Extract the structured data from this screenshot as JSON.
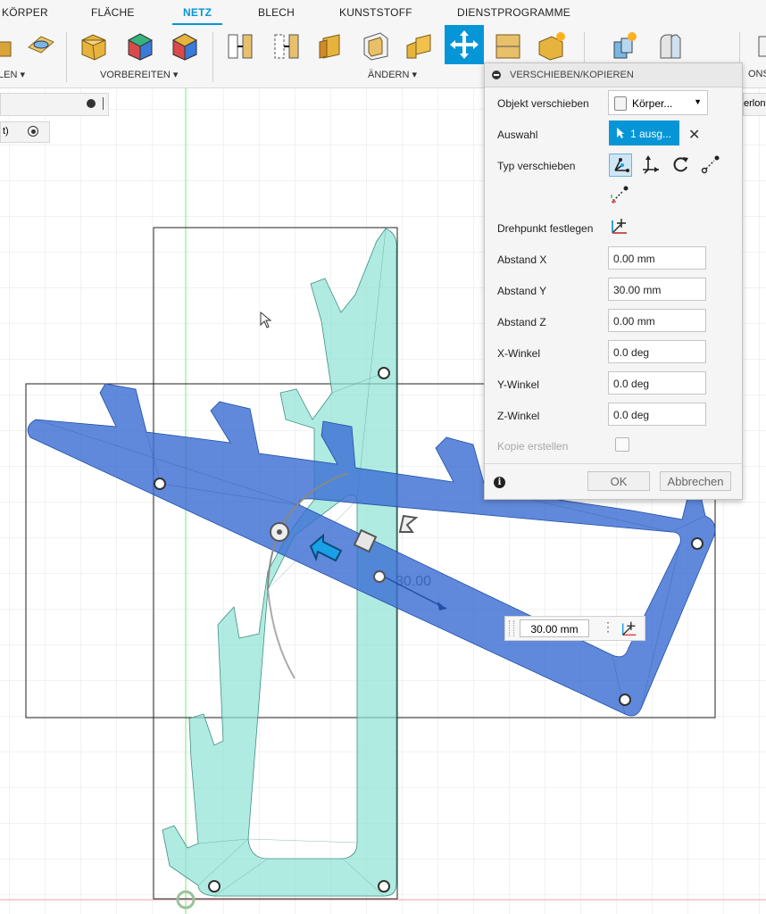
{
  "tabs": [
    {
      "label": "KÖRPER"
    },
    {
      "label": "FLÄCHE"
    },
    {
      "label": "NETZ"
    },
    {
      "label": "BLECH"
    },
    {
      "label": "KUNSTSTOFF"
    },
    {
      "label": "DIENSTPROGRAMME"
    }
  ],
  "active_tab": "NETZ",
  "ribbon_groups": {
    "left_partial": "LEN ▾",
    "prepare": "VORBEREITEN ▾",
    "modify": "ÄNDERN ▾",
    "right_partial": "ONST"
  },
  "browser": {
    "row_label": "t)",
    "right_partial": "erlon"
  },
  "dialog": {
    "title": "VERSCHIEBEN/KOPIEREN",
    "object_move_label": "Objekt verschieben",
    "object_move_value": "Körper...",
    "selection_label": "Auswahl",
    "selection_value": "1 ausg...",
    "move_type_label": "Typ verschieben",
    "pivot_label": "Drehpunkt festlegen",
    "distance_x_label": "Abstand X",
    "distance_x_value": "0.00 mm",
    "distance_y_label": "Abstand Y",
    "distance_y_value": "30.00 mm",
    "distance_z_label": "Abstand Z",
    "distance_z_value": "0.00 mm",
    "angle_x_label": "X-Winkel",
    "angle_x_value": "0.0 deg",
    "angle_y_label": "Y-Winkel",
    "angle_y_value": "0.0 deg",
    "angle_z_label": "Z-Winkel",
    "angle_z_value": "0.0 deg",
    "create_copy_label": "Kopie erstellen",
    "create_copy_checked": false,
    "ok_label": "OK",
    "cancel_label": "Abbrechen"
  },
  "canvas": {
    "drag_value": "30.00",
    "mini_input_value": "30.00 mm"
  },
  "colors": {
    "accent": "#0696d7",
    "body_blue": "#3d6fd3",
    "body_teal": "#8fe3d4",
    "grid": "#e2e2e2"
  }
}
